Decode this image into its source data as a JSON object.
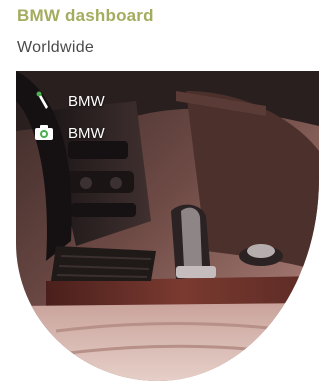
{
  "header": {
    "title": "BMW dashboard",
    "subtitle": "Worldwide"
  },
  "photo": {
    "description_icon": "car-interior-photo",
    "labels": [
      {
        "icon": "pin-icon",
        "text": "BMW"
      },
      {
        "icon": "camera-icon",
        "text": "BMW"
      }
    ]
  },
  "colors": {
    "title": "#a4ad5f",
    "subtitle": "#4a4a4a",
    "overlay_text": "#ffffff"
  }
}
